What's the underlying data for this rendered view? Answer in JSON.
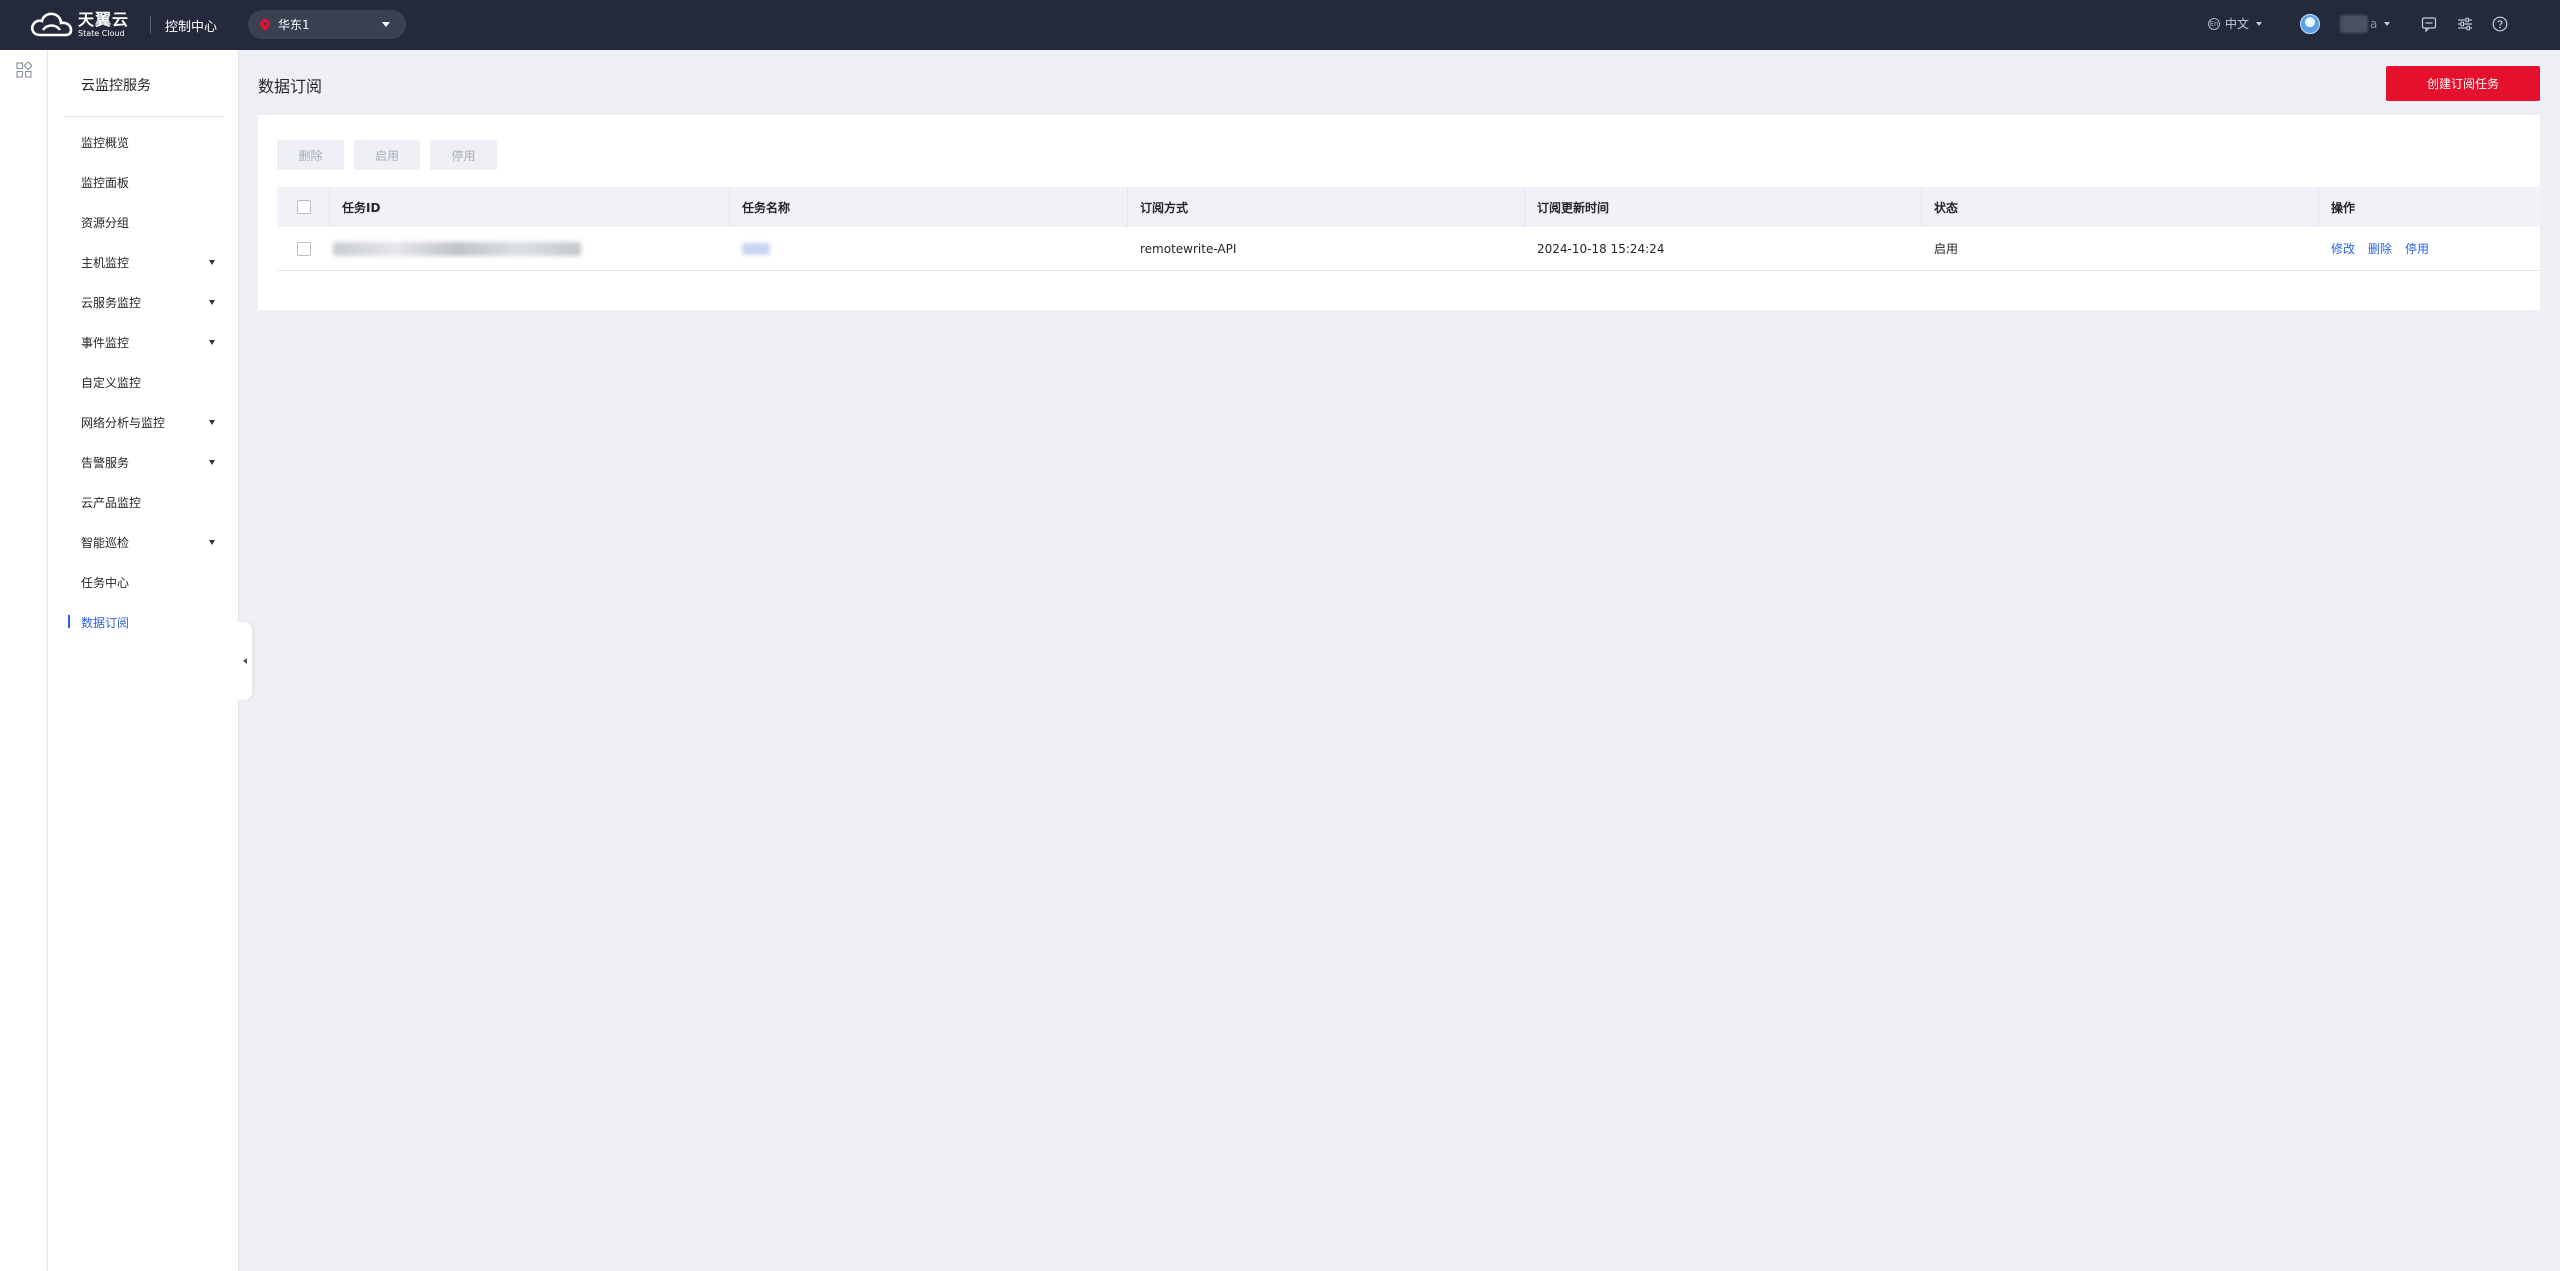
{
  "topbar": {
    "logo_cn": "天翼云",
    "logo_en": "State Cloud",
    "console_title": "控制中心",
    "region": "华东1",
    "language": "中文",
    "username_suffix": "a",
    "icons": [
      "message-icon",
      "settings-sliders-icon",
      "help-icon"
    ]
  },
  "sidebar": {
    "title": "云监控服务",
    "items": [
      {
        "label": "监控概览",
        "expandable": false
      },
      {
        "label": "监控面板",
        "expandable": false
      },
      {
        "label": "资源分组",
        "expandable": false
      },
      {
        "label": "主机监控",
        "expandable": true
      },
      {
        "label": "云服务监控",
        "expandable": true
      },
      {
        "label": "事件监控",
        "expandable": true
      },
      {
        "label": "自定义监控",
        "expandable": false
      },
      {
        "label": "网络分析与监控",
        "expandable": true
      },
      {
        "label": "告警服务",
        "expandable": true
      },
      {
        "label": "云产品监控",
        "expandable": false
      },
      {
        "label": "智能巡检",
        "expandable": true
      },
      {
        "label": "任务中心",
        "expandable": false
      },
      {
        "label": "数据订阅",
        "expandable": false,
        "active": true
      }
    ]
  },
  "main": {
    "title": "数据订阅",
    "create_button": "创建订阅任务",
    "toolbar": {
      "delete": "删除",
      "enable": "启用",
      "disable": "停用"
    },
    "table": {
      "columns": [
        "任务ID",
        "任务名称",
        "订阅方式",
        "订阅更新时间",
        "状态",
        "操作"
      ],
      "rows": [
        {
          "task_id": "",
          "task_name": "",
          "method": "remotewrite-API",
          "updated": "2024-10-18 15:24:24",
          "status": "启用",
          "actions": {
            "edit": "修改",
            "delete": "删除",
            "disable": "停用"
          }
        }
      ]
    }
  },
  "colors": {
    "topbar_bg": "#242a3b",
    "accent_red": "#e5102c",
    "link_blue": "#2b62e3",
    "page_bg": "#eff0f5"
  }
}
